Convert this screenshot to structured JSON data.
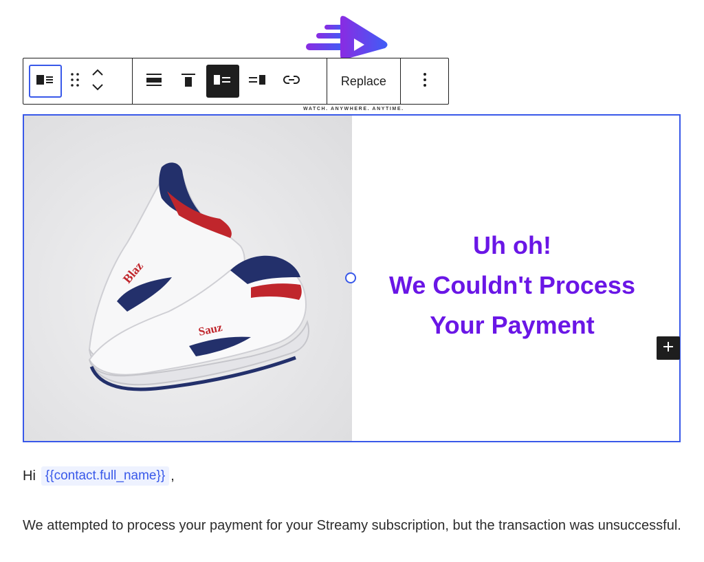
{
  "logo": {
    "tagline": "WATCH. ANYWHERE. ANYTIME.",
    "gradient": [
      "#8a2be2",
      "#3f5ef6"
    ]
  },
  "toolbar": {
    "icons": [
      "media-text-block-icon",
      "drag-handle-icon",
      "move-up-icon",
      "move-down-icon",
      "align-icon",
      "vertical-align-top-icon",
      "media-on-left-icon",
      "media-on-right-icon",
      "link-icon",
      "more-options-icon"
    ],
    "replace_label": "Replace"
  },
  "media_text": {
    "heading_line1": "Uh oh!",
    "heading_line2": "We Couldn't Process",
    "heading_line3": "Your Payment",
    "heading_color": "#6a16e6",
    "image_alt": "White sneakers with navy and red accents"
  },
  "content": {
    "greeting_prefix": "Hi",
    "merge_tag": "{{contact.full_name}}",
    "greeting_suffix": ",",
    "paragraph": "We attempted to process your payment for your Streamy subscription, but the transaction was unsuccessful."
  },
  "colors": {
    "selection": "#3858e9",
    "toolbar_dark": "#1e1e1e"
  }
}
